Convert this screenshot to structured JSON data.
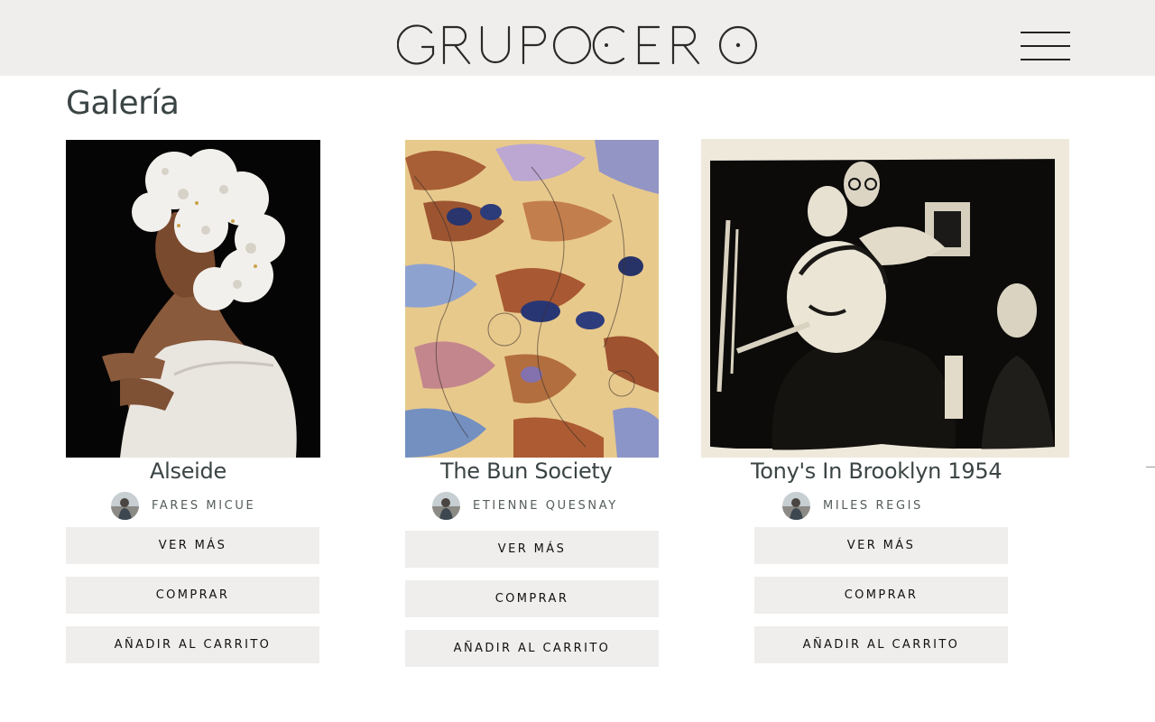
{
  "header": {
    "logo_text": "GRUPOCERO",
    "menu_icon": "hamburger-menu-icon"
  },
  "page": {
    "title": "Galería"
  },
  "artworks": [
    {
      "title": "Alseide",
      "artist": "FARES MICUE",
      "buttons": {
        "view": "VER MÁS",
        "buy": "COMPRAR",
        "cart": "AÑADIR AL CARRITO"
      }
    },
    {
      "title": "The Bun Society",
      "artist": "ETIENNE QUESNAY",
      "buttons": {
        "view": "VER MÁS",
        "buy": "COMPRAR",
        "cart": "AÑADIR AL CARRITO"
      }
    },
    {
      "title": "Tony's In Brooklyn 1954",
      "artist": "MILES REGIS",
      "buttons": {
        "view": "VER MÁS",
        "buy": "COMPRAR",
        "cart": "AÑADIR AL CARRITO"
      }
    }
  ],
  "colors": {
    "header_bg": "#efeeec",
    "button_bg": "#efeeec",
    "title_text": "#3b4444"
  }
}
